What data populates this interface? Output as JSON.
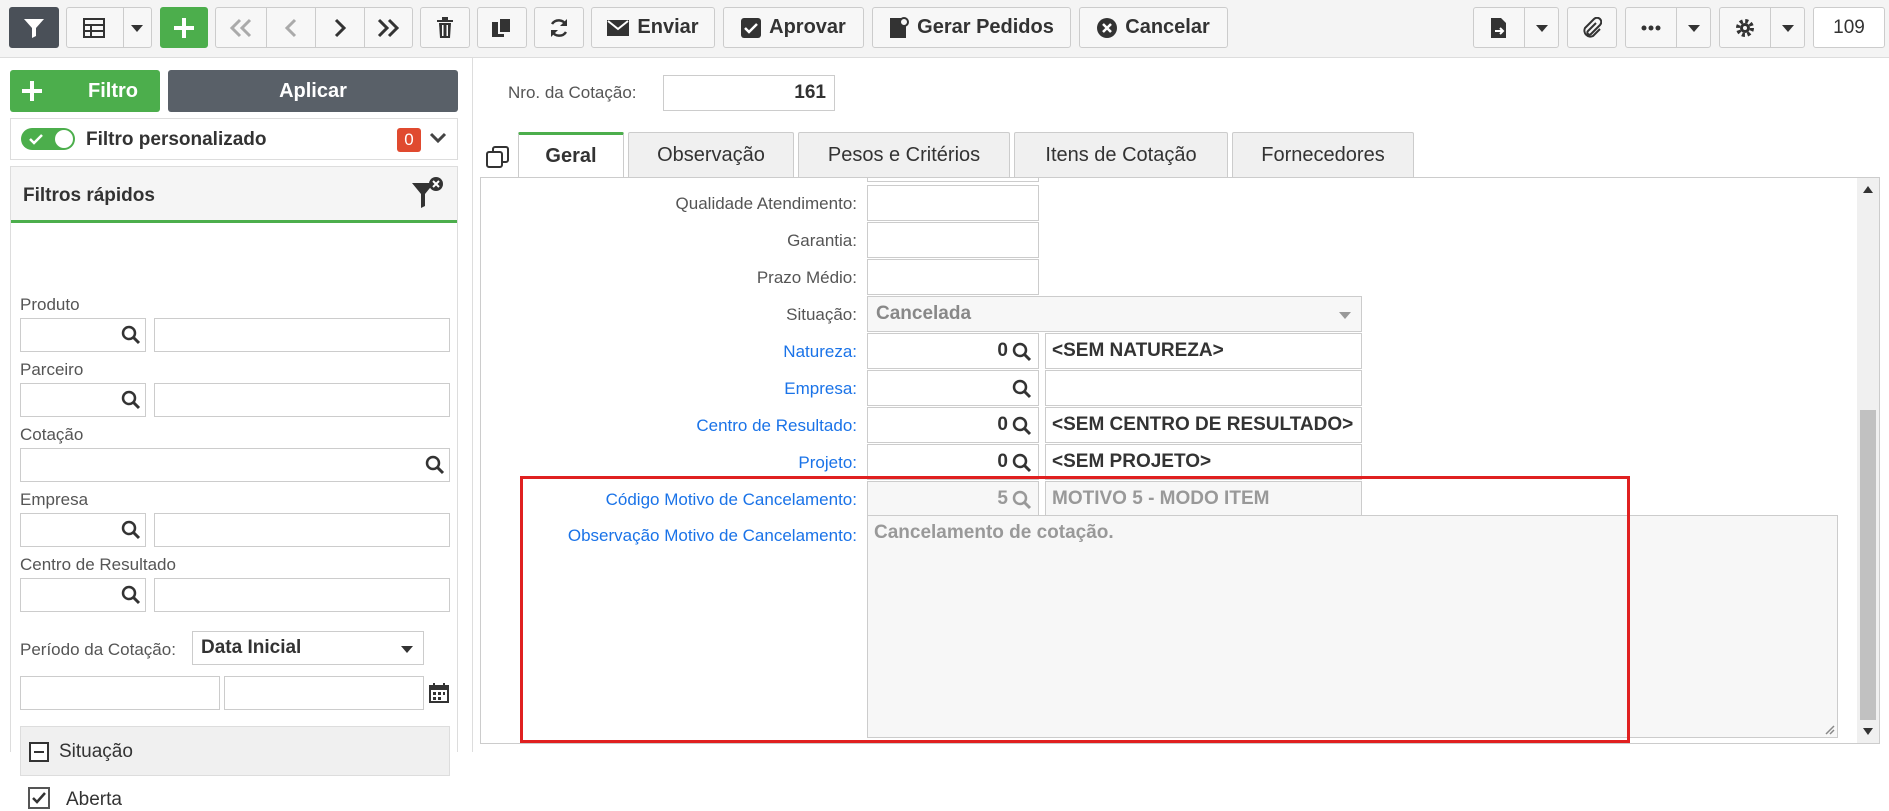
{
  "toolbar": {
    "send_label": "Enviar",
    "approve_label": "Aprovar",
    "generate_orders_label": "Gerar Pedidos",
    "cancel_label": "Cancelar",
    "record_count": "109"
  },
  "filter_panel": {
    "filter_button_label": "Filtro",
    "apply_button_label": "Aplicar",
    "custom_filter_label": "Filtro personalizado",
    "custom_filter_count": "0",
    "quick_filters_title": "Filtros rápidos",
    "fields": {
      "produto": "Produto",
      "parceiro": "Parceiro",
      "cotacao": "Cotação",
      "empresa": "Empresa",
      "centro_resultado": "Centro de Resultado"
    },
    "period_label": "Período da Cotação:",
    "period_select": "Data Inicial",
    "situacao_title": "Situação",
    "situacao_first_option": "Aberta"
  },
  "form": {
    "nro_cotacao_label": "Nro. da Cotação:",
    "nro_cotacao_value": "161",
    "tabs": [
      "Geral",
      "Observação",
      "Pesos e Critérios",
      "Itens de Cotação",
      "Fornecedores"
    ],
    "rows": {
      "qualidade_label": "Qualidade Atendimento:",
      "garantia_label": "Garantia:",
      "prazo_label": "Prazo Médio:",
      "situacao_label": "Situação:",
      "situacao_value": "Cancelada",
      "natureza_label": "Natureza:",
      "natureza_code": "0",
      "natureza_desc": "<SEM NATUREZA>",
      "empresa_label": "Empresa:",
      "centro_label": "Centro de Resultado:",
      "centro_code": "0",
      "centro_desc": "<SEM CENTRO DE RESULTADO>",
      "projeto_label": "Projeto:",
      "projeto_code": "0",
      "projeto_desc": "<SEM PROJETO>",
      "motivo_label": "Código Motivo de Cancelamento:",
      "motivo_code": "5",
      "motivo_desc": "MOTIVO 5 - MODO ITEM",
      "obs_motivo_label": "Observação Motivo de Cancelamento:",
      "obs_motivo_value": "Cancelamento de cotação."
    }
  },
  "colors": {
    "accent_green": "#4cae4c",
    "link_blue": "#1a73e8",
    "highlight_red": "#e02020",
    "apply_gray": "#596068"
  }
}
